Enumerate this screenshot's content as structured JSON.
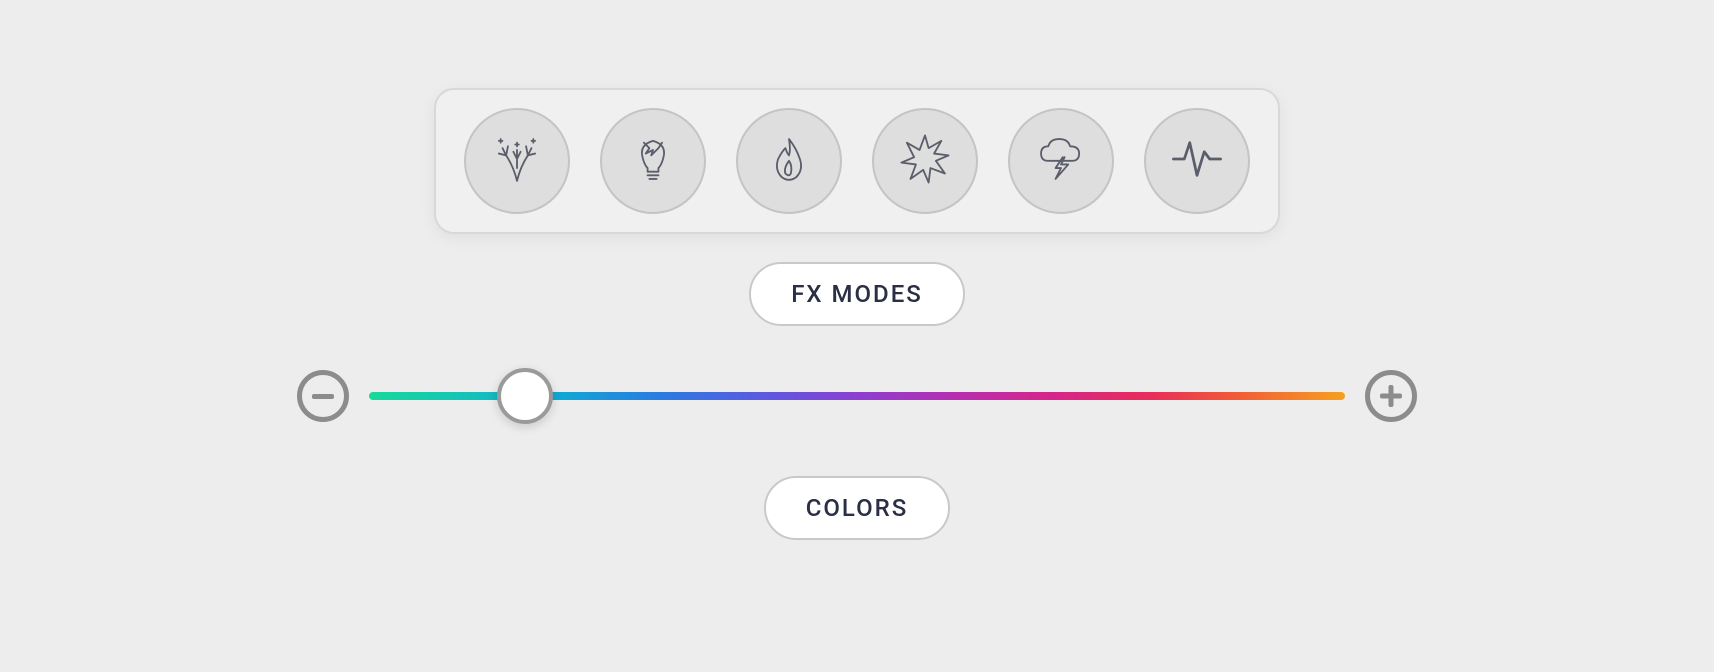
{
  "fx_modes": {
    "label": "FX MODES",
    "items": [
      {
        "name": "fireworks"
      },
      {
        "name": "broken-bulb"
      },
      {
        "name": "flame"
      },
      {
        "name": "explosion"
      },
      {
        "name": "storm"
      },
      {
        "name": "pulse"
      }
    ]
  },
  "colors": {
    "label": "COLORS",
    "slider_position_percent": 16
  }
}
